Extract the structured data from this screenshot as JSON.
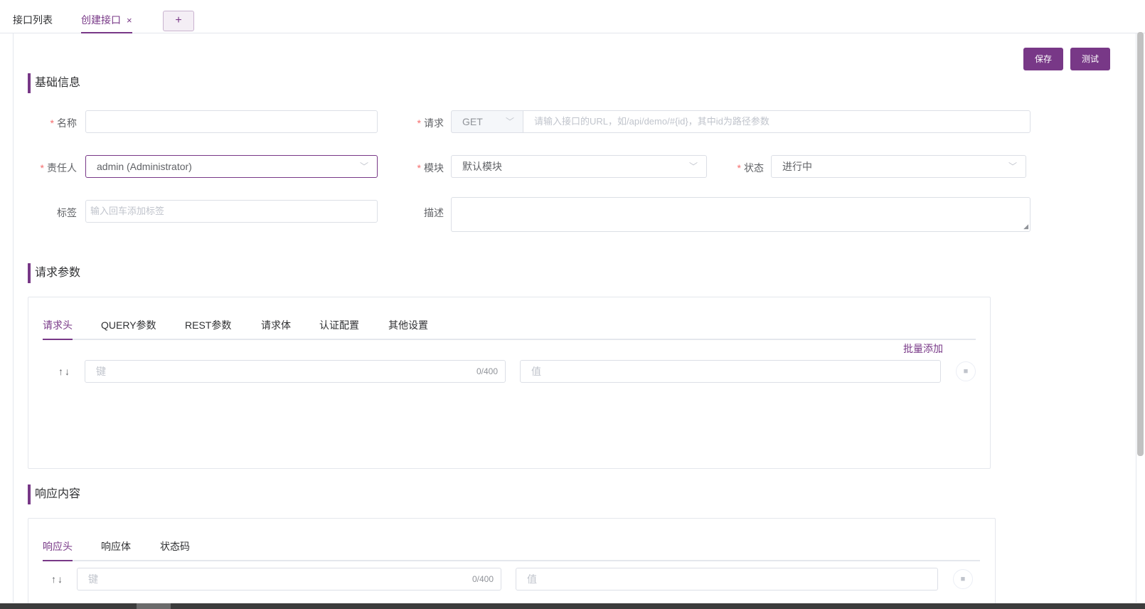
{
  "tabs": {
    "list_label": "接口列表",
    "create_label": "创建接口",
    "close_glyph": "×",
    "add_glyph": "+"
  },
  "toolbar": {
    "save_label": "保存",
    "test_label": "测试"
  },
  "basic": {
    "title": "基础信息",
    "name_label": "名称",
    "name_value": "",
    "request_label": "请求",
    "method_value": "GET",
    "url_placeholder": "请输入接口的URL，如/api/demo/#{id}，其中id为路径参数",
    "owner_label": "责任人",
    "owner_value": "admin (Administrator)",
    "module_label": "模块",
    "module_value": "默认模块",
    "status_label": "状态",
    "status_value": "进行中",
    "tag_label": "标签",
    "tag_placeholder": "输入回车添加标签",
    "desc_label": "描述",
    "required_mark": "*"
  },
  "request_params": {
    "title": "请求参数",
    "tabs": [
      "请求头",
      "QUERY参数",
      "REST参数",
      "请求体",
      "认证配置",
      "其他设置"
    ],
    "active_tab": "请求头",
    "batch_add_label": "批量添加",
    "sort_arrows": "↑↓",
    "key_placeholder": "键",
    "key_counter": "0/400",
    "value_placeholder": "值"
  },
  "response": {
    "title": "响应内容",
    "tabs": [
      "响应头",
      "响应体",
      "状态码"
    ],
    "active_tab": "响应头",
    "sort_arrows": "↑↓",
    "key_placeholder": "键",
    "key_counter": "0/400",
    "value_placeholder": "值"
  },
  "icons": {
    "chevron": "chevron-down-icon",
    "delete": "trash-icon",
    "close": "close-icon",
    "add": "plus-icon"
  },
  "colors": {
    "accent": "#783887",
    "required": "#f56c6c",
    "border": "#dcdfe6"
  }
}
